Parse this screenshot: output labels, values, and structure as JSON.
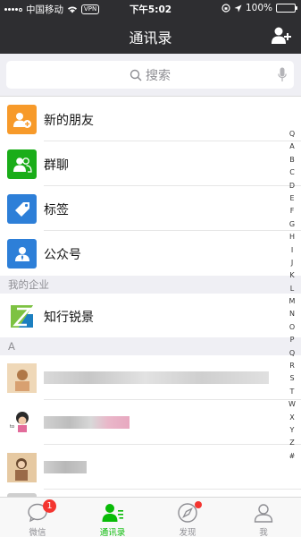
{
  "status_bar": {
    "carrier": "中国移动",
    "vpn": "VPN",
    "time": "下午5:02",
    "battery_text": "100%",
    "battery_level": 1.0
  },
  "nav": {
    "title": "通讯录"
  },
  "search": {
    "placeholder": "搜索"
  },
  "fixed_items": [
    {
      "label": "新的朋友",
      "icon": "new-friends-icon",
      "color": "#f79a2a"
    },
    {
      "label": "群聊",
      "icon": "group-chat-icon",
      "color": "#1aad19"
    },
    {
      "label": "标签",
      "icon": "tag-icon",
      "color": "#2d7fd8"
    },
    {
      "label": "公众号",
      "icon": "official-account-icon",
      "color": "#2d7fd8"
    }
  ],
  "enterprise_section": {
    "header": "我的企业",
    "item_label": "知行锐景"
  },
  "contact_section": {
    "header": "A"
  },
  "index_letters": [
    "Q",
    "A",
    "B",
    "C",
    "D",
    "E",
    "F",
    "G",
    "H",
    "I",
    "J",
    "K",
    "L",
    "M",
    "N",
    "O",
    "P",
    "Q",
    "R",
    "S",
    "T",
    "W",
    "X",
    "Y",
    "Z",
    "#"
  ],
  "tabs": [
    {
      "label": "微信",
      "icon": "chat-bubble-icon",
      "badge": "1"
    },
    {
      "label": "通讯录",
      "icon": "contacts-icon",
      "active": true
    },
    {
      "label": "发现",
      "icon": "compass-icon",
      "dot": true
    },
    {
      "label": "我",
      "icon": "person-icon"
    }
  ],
  "colors": {
    "header_bg": "#2e2e31",
    "accent": "#09bb07",
    "badge": "#f43530"
  }
}
